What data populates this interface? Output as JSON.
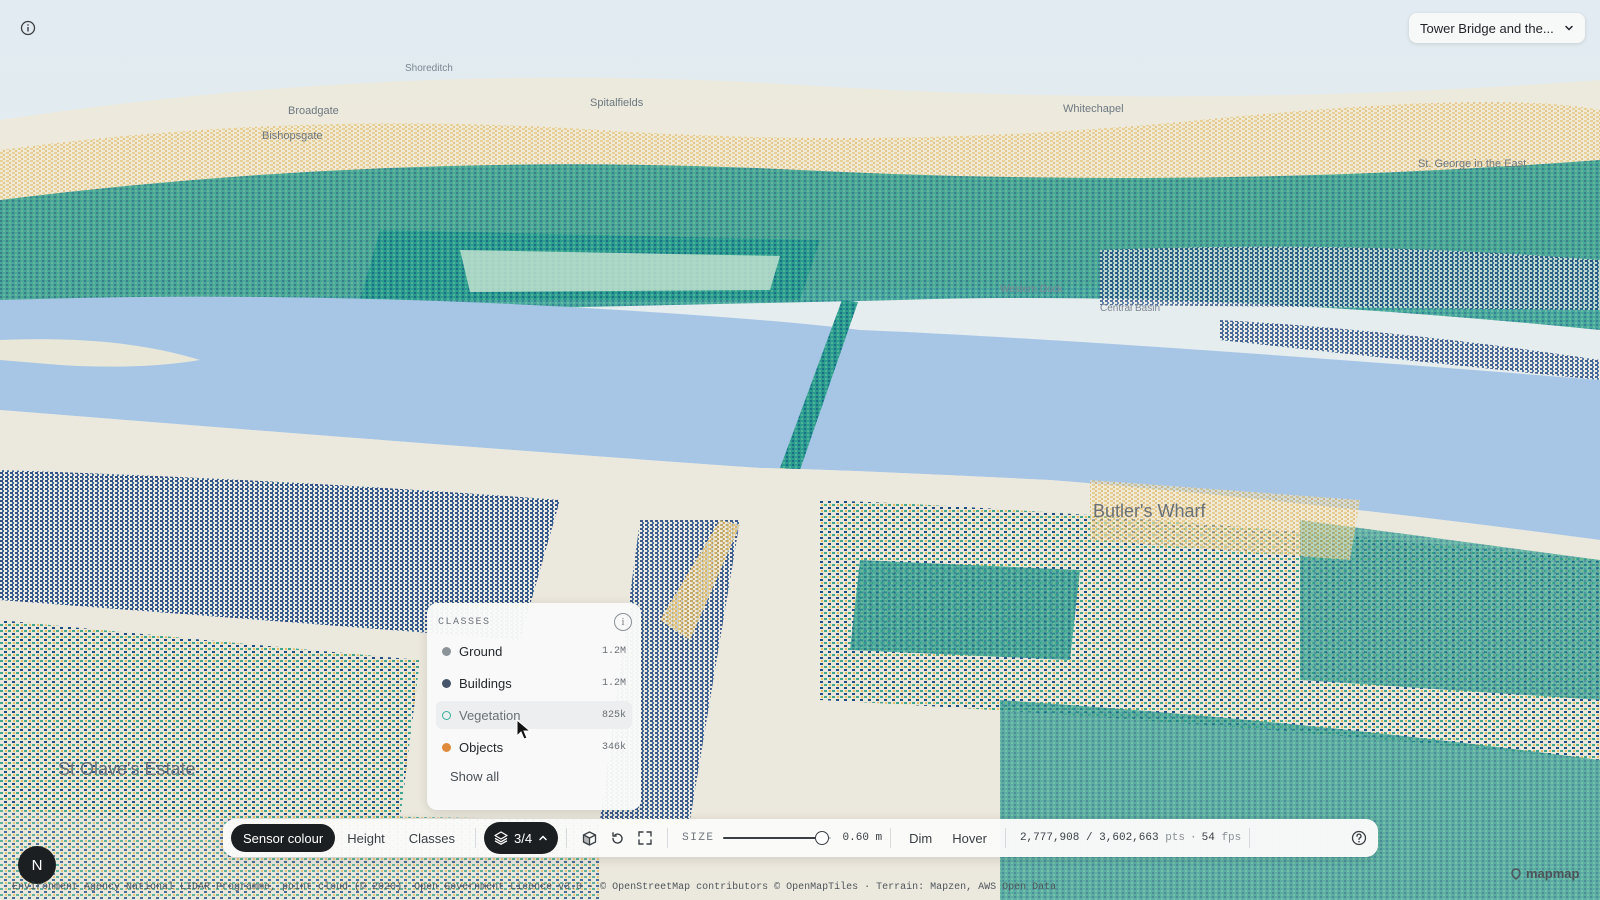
{
  "map": {
    "labels": [
      {
        "text": "Shoreditch",
        "size": "sm"
      },
      {
        "text": "Broadgate",
        "size": "md"
      },
      {
        "text": "Spitalfields",
        "size": "md"
      },
      {
        "text": "Bishopsgate",
        "size": "md"
      },
      {
        "text": "Whitechapel",
        "size": "md"
      },
      {
        "text": "St. George in the East",
        "size": "md"
      },
      {
        "text": "Western Dock",
        "size": "sm"
      },
      {
        "text": "Central Basin",
        "size": "sm"
      },
      {
        "text": "Butler's Wharf",
        "size": "lg"
      },
      {
        "text": "St Olave's Estate",
        "size": "lg"
      }
    ],
    "colors": {
      "river": "#a7c6e6",
      "ground": "#ece9de",
      "teal": "#1f8f88",
      "navy": "#1c3f7a",
      "gold": "#e2bd62",
      "cream": "#f3ecd5"
    }
  },
  "location": {
    "selected": "Tower Bridge and the..."
  },
  "classes": {
    "title": "CLASSES",
    "info_glyph": "i",
    "items": [
      {
        "name": "Ground",
        "count": "1.2M",
        "color": "#8c9399",
        "enabled": true
      },
      {
        "name": "Buildings",
        "count": "1.2M",
        "color": "#46556a",
        "enabled": true
      },
      {
        "name": "Vegetation",
        "count": "825k",
        "color": "#36b09b",
        "enabled": false
      },
      {
        "name": "Objects",
        "count": "346k",
        "color": "#e08a3c",
        "enabled": true
      }
    ],
    "show_all": "Show all"
  },
  "toolbar": {
    "color_modes": [
      "Sensor colour",
      "Height",
      "Classes"
    ],
    "active_mode": "Sensor colour",
    "layers_label": "3/4",
    "size_label": "SIZE",
    "size_value": "0.60 m",
    "size_fraction": 0.92,
    "dim_label": "Dim",
    "hover_label": "Hover",
    "points_visible": "2,777,908",
    "points_total": "3,602,663",
    "points_unit": "pts",
    "fps": "54",
    "fps_unit": "fps"
  },
  "compass": {
    "label": "N"
  },
  "attribution": "Environment Agency National LIDAR Programme, point cloud (© 2020). Open Government Licence v3.0 · © OpenStreetMap contributors © OpenMapTiles · Terrain: Mapzen, AWS Open Data",
  "brand": "mapmap"
}
